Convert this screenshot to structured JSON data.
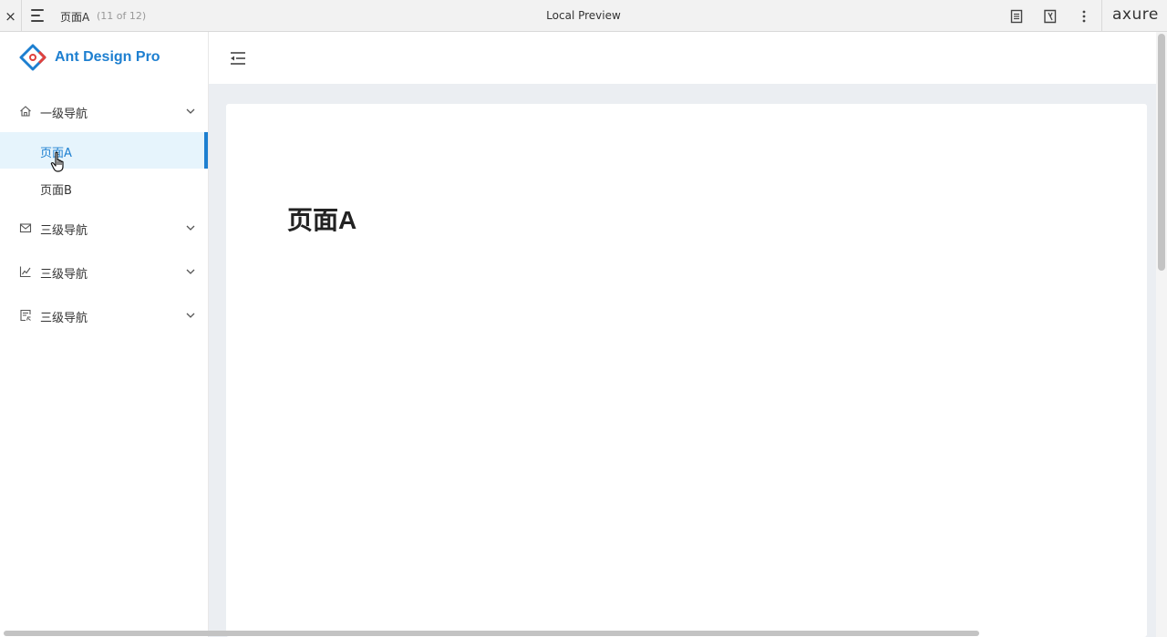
{
  "topbar": {
    "close_icon": "×",
    "page_name": "页面A",
    "page_count": "(11 of 12)",
    "window_title": "Local Preview",
    "logo_text": "axure"
  },
  "sidebar": {
    "brand_name": "Ant Design Pro",
    "groups": [
      {
        "label": "一级导航",
        "icon": "home-icon"
      },
      {
        "label": "三级导航",
        "icon": "mail-icon"
      },
      {
        "label": "三级导航",
        "icon": "line-chart-icon"
      },
      {
        "label": "三级导航",
        "icon": "form-icon"
      }
    ],
    "sub_items": [
      {
        "label": "页面A",
        "selected": true
      },
      {
        "label": "页面B",
        "selected": false
      }
    ]
  },
  "content": {
    "page_title": "页面A"
  },
  "colors": {
    "accent": "#1d7fd0",
    "selected_bg": "#e6f4fc",
    "content_bg": "#ebeef2"
  }
}
